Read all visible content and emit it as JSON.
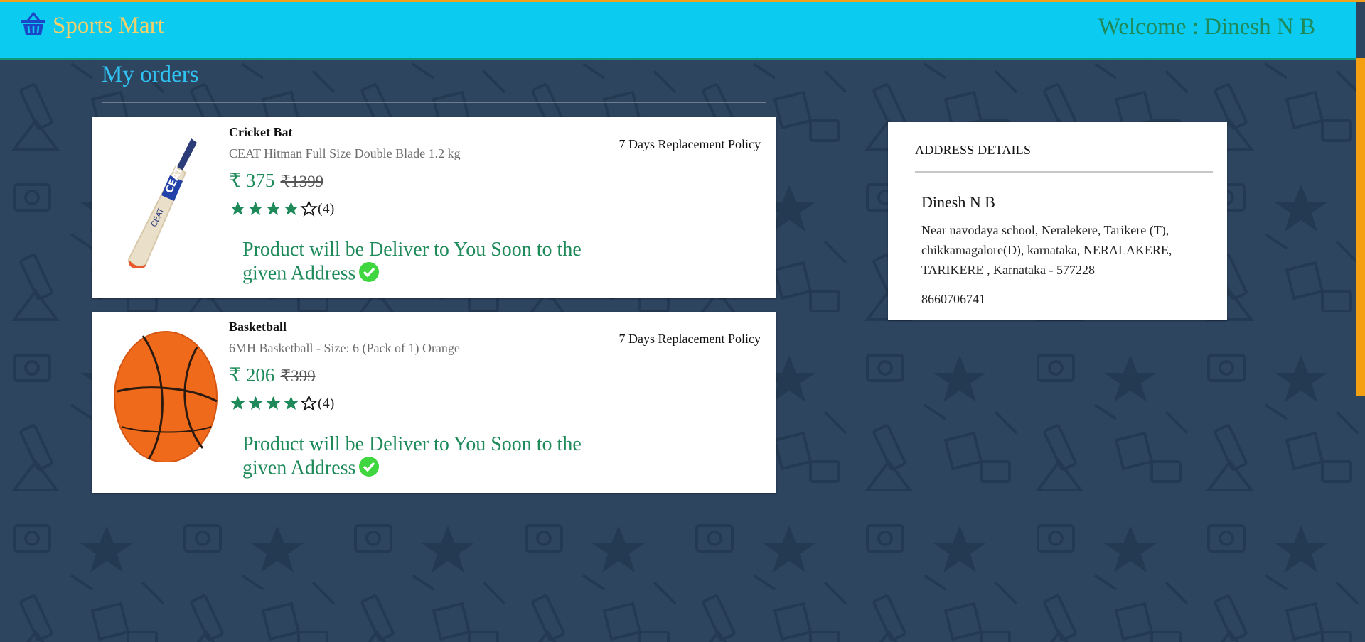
{
  "header": {
    "brand_icon": "basket-icon",
    "brand_name": "Sports Mart",
    "welcome_text": "Welcome : Dinesh N B"
  },
  "page": {
    "title": "My orders"
  },
  "orders": [
    {
      "name": "Cricket Bat",
      "description": "CEAT Hitman Full Size Double Blade 1.2 kg",
      "price": "₹ 375",
      "old_price": "₹1399",
      "rating_count": "(4)",
      "rating_value": 4,
      "policy": "7 Days Replacement Policy",
      "delivery_message": "Product will be Deliver to You Soon to the given Address",
      "image_icon": "cricket-bat-image"
    },
    {
      "name": "Basketball",
      "description": "6MH Basketball - Size: 6 (Pack of 1) Orange",
      "price": "₹ 206",
      "old_price": "₹399",
      "rating_count": "(4)",
      "rating_value": 4,
      "policy": "7 Days Replacement Policy",
      "delivery_message": "Product will be Deliver to You Soon to the given Address",
      "image_icon": "basketball-image"
    }
  ],
  "address": {
    "heading": "ADDRESS DETAILS",
    "name": "Dinesh N B",
    "address_text": "Near navodaya school, Neralekere, Tarikere (T), chikkamagalore(D), karnataka, NERALAKERE, TARIKERE , Karnataka - 577228",
    "phone": "8660706741"
  },
  "colors": {
    "header_bg": "#0ccbf0",
    "brand": "#f3d06a",
    "accent_green": "#1e8a5a",
    "page_bg": "#2e4560",
    "title_blue": "#2fc2f2"
  }
}
